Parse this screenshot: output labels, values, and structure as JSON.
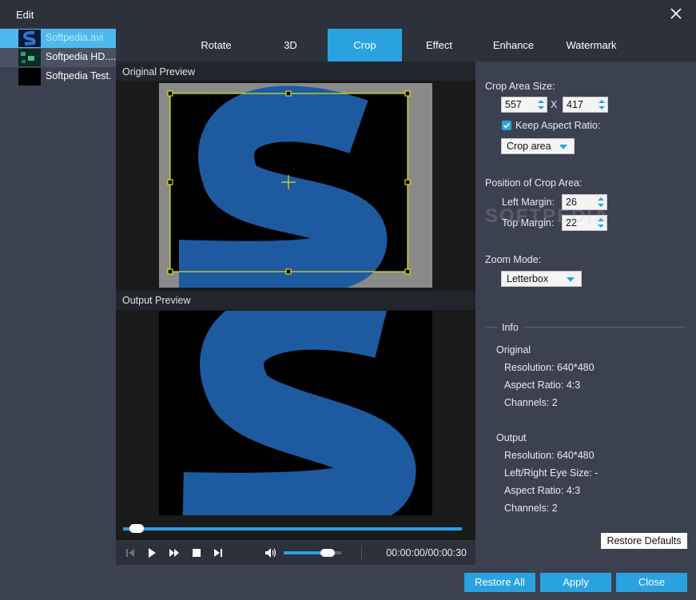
{
  "window": {
    "title": "Edit"
  },
  "files": [
    {
      "name": "Softpedia.avi"
    },
    {
      "name": "Softpedia HD...."
    },
    {
      "name": "Softpedia Test."
    }
  ],
  "tabs": [
    "Rotate",
    "3D",
    "Crop",
    "Effect",
    "Enhance",
    "Watermark"
  ],
  "active_tab": "Crop",
  "preview": {
    "original_label": "Original Preview",
    "output_label": "Output Preview",
    "timecode": "00:00:00/00:00:30",
    "progress": 0.02,
    "volume": 0.85
  },
  "crop": {
    "area_size_label": "Crop Area Size:",
    "width": "557",
    "x_sep": "X",
    "height": "417",
    "keep_aspect_label": "Keep Aspect Ratio:",
    "keep_aspect_checked": true,
    "aspect_mode": "Crop area",
    "position_label": "Position of Crop Area:",
    "left_margin_label": "Left Margin:",
    "left_margin": "26",
    "top_margin_label": "Top Margin:",
    "top_margin": "22",
    "zoom_label": "Zoom Mode:",
    "zoom_mode": "Letterbox"
  },
  "info": {
    "heading": "Info",
    "original": {
      "heading": "Original",
      "resolution": "Resolution: 640*480",
      "aspect": "Aspect Ratio: 4:3",
      "channels": "Channels: 2"
    },
    "output": {
      "heading": "Output",
      "resolution": "Resolution: 640*480",
      "eye_size": "Left/Right Eye Size: -",
      "aspect": "Aspect Ratio: 4:3",
      "channels": "Channels: 2"
    }
  },
  "buttons": {
    "restore_defaults": "Restore Defaults",
    "restore_all": "Restore All",
    "apply": "Apply",
    "close": "Close"
  },
  "watermark_text": "SOFTPEDIA",
  "colors": {
    "accent": "#2aa2e0",
    "panel": "#3b4150",
    "dark": "#2c313c",
    "logo_blue": "#1e5aa0",
    "crop_box": "#ffff00"
  }
}
